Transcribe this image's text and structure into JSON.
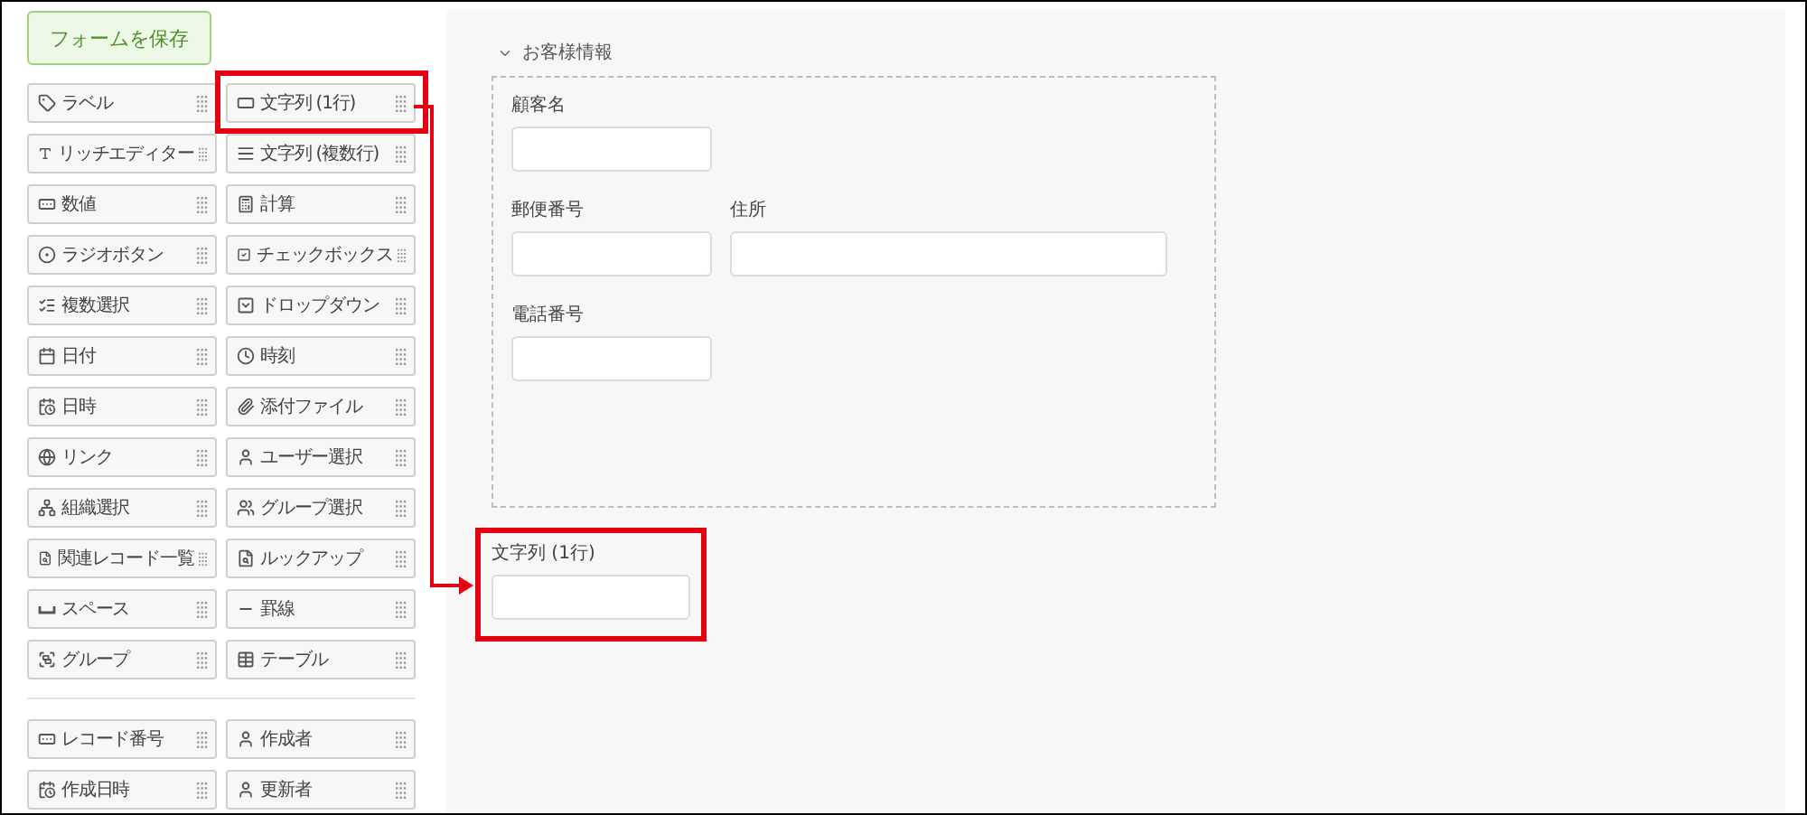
{
  "save_button": {
    "label": "フォームを保存"
  },
  "palette": {
    "groups": [
      {
        "items": [
          {
            "label": "ラベル",
            "kind": "label",
            "highlighted": false
          },
          {
            "label": "文字列 (1行)",
            "kind": "single-line",
            "highlighted": true
          },
          {
            "label": "リッチエディター",
            "kind": "rich",
            "highlighted": false
          },
          {
            "label": "文字列 (複数行)",
            "kind": "multi-line",
            "highlighted": false
          },
          {
            "label": "数値",
            "kind": "number",
            "highlighted": false
          },
          {
            "label": "計算",
            "kind": "calc",
            "highlighted": false
          },
          {
            "label": "ラジオボタン",
            "kind": "radio",
            "highlighted": false
          },
          {
            "label": "チェックボックス",
            "kind": "checkbox",
            "highlighted": false
          },
          {
            "label": "複数選択",
            "kind": "multi-select",
            "highlighted": false
          },
          {
            "label": "ドロップダウン",
            "kind": "dropdown",
            "highlighted": false
          },
          {
            "label": "日付",
            "kind": "date",
            "highlighted": false
          },
          {
            "label": "時刻",
            "kind": "time",
            "highlighted": false
          },
          {
            "label": "日時",
            "kind": "datetime",
            "highlighted": false
          },
          {
            "label": "添付ファイル",
            "kind": "file",
            "highlighted": false
          },
          {
            "label": "リンク",
            "kind": "link",
            "highlighted": false
          },
          {
            "label": "ユーザー選択",
            "kind": "user",
            "highlighted": false
          },
          {
            "label": "組織選択",
            "kind": "org",
            "highlighted": false
          },
          {
            "label": "グループ選択",
            "kind": "group-select",
            "highlighted": false
          },
          {
            "label": "関連レコード一覧",
            "kind": "related",
            "highlighted": false
          },
          {
            "label": "ルックアップ",
            "kind": "lookup",
            "highlighted": false
          },
          {
            "label": "スペース",
            "kind": "space",
            "highlighted": false
          },
          {
            "label": "罫線",
            "kind": "rule",
            "highlighted": false
          },
          {
            "label": "グループ",
            "kind": "group",
            "highlighted": false
          },
          {
            "label": "テーブル",
            "kind": "table",
            "highlighted": false
          }
        ]
      },
      {
        "items": [
          {
            "label": "レコード番号",
            "kind": "number",
            "highlighted": false
          },
          {
            "label": "作成者",
            "kind": "user",
            "highlighted": false
          },
          {
            "label": "作成日時",
            "kind": "datetime",
            "highlighted": false
          },
          {
            "label": "更新者",
            "kind": "user",
            "highlighted": false
          }
        ]
      }
    ]
  },
  "section": {
    "title": "お客様情報",
    "expanded": true,
    "rows": [
      [
        {
          "label": "顧客名",
          "wide": false
        }
      ],
      [
        {
          "label": "郵便番号",
          "wide": false
        },
        {
          "label": "住所",
          "wide": true
        }
      ],
      [
        {
          "label": "電話番号",
          "wide": false
        }
      ]
    ]
  },
  "dropped_field": {
    "label": "文字列 (1行)",
    "highlighted": true
  }
}
